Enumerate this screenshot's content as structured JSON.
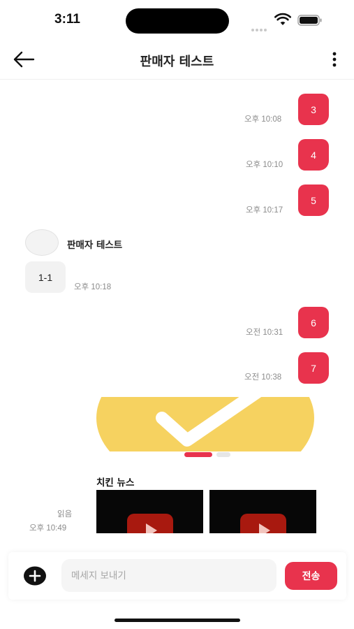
{
  "status_bar": {
    "time": "3:11"
  },
  "header": {
    "title": "판매자 테스트"
  },
  "messages": {
    "out": [
      {
        "text": "3",
        "time": "오후 10:08"
      },
      {
        "text": "4",
        "time": "오후 10:10"
      },
      {
        "text": "5",
        "time": "오후 10:17"
      },
      {
        "text": "6",
        "time": "오전 10:31"
      },
      {
        "text": "7",
        "time": "오전 10:38"
      }
    ],
    "in": {
      "sender": "판매자 테스트",
      "text": "1-1",
      "time": "오후 10:18"
    },
    "card": {
      "title": "치킨 뉴스",
      "read_status": "읽음",
      "time": "오후 10:49",
      "carousel": {
        "active_index": 0,
        "count": 2
      }
    }
  },
  "composer": {
    "placeholder": "메세지 보내기",
    "send_label": "전송"
  },
  "colors": {
    "accent": "#e8334d",
    "banner_yellow": "#f6d260",
    "play_red": "#a8190f"
  }
}
